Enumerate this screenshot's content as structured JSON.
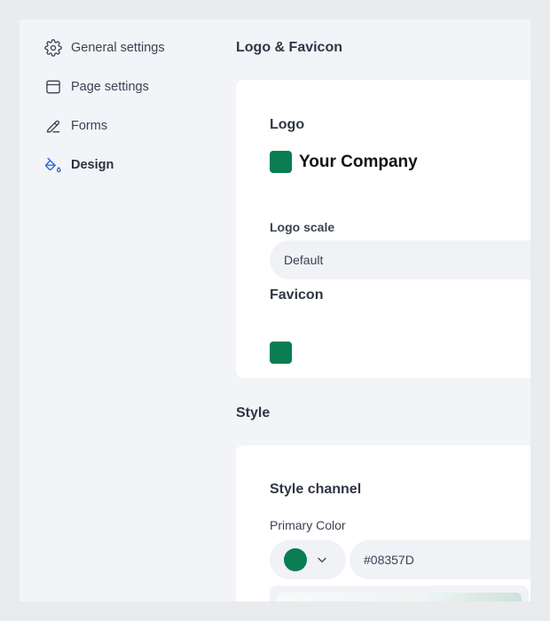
{
  "sidebar": {
    "items": [
      {
        "label": "General settings",
        "icon": "gear-icon"
      },
      {
        "label": "Page settings",
        "icon": "page-icon"
      },
      {
        "label": "Forms",
        "icon": "pencil-icon"
      },
      {
        "label": "Design",
        "icon": "paint-bucket-icon",
        "active": true
      }
    ]
  },
  "logo_section": {
    "title": "Logo & Favicon",
    "logo_label": "Logo",
    "company_name": "Your Company",
    "logo_scale_label": "Logo scale",
    "logo_scale_value": "Default",
    "favicon_label": "Favicon"
  },
  "style_section": {
    "title": "Style",
    "channel_label": "Style channel",
    "primary_color_label": "Primary Color",
    "primary_color_value": "#08357D"
  },
  "colors": {
    "brand_green": "#0A7D52",
    "active_icon": "#2f6bd8"
  }
}
